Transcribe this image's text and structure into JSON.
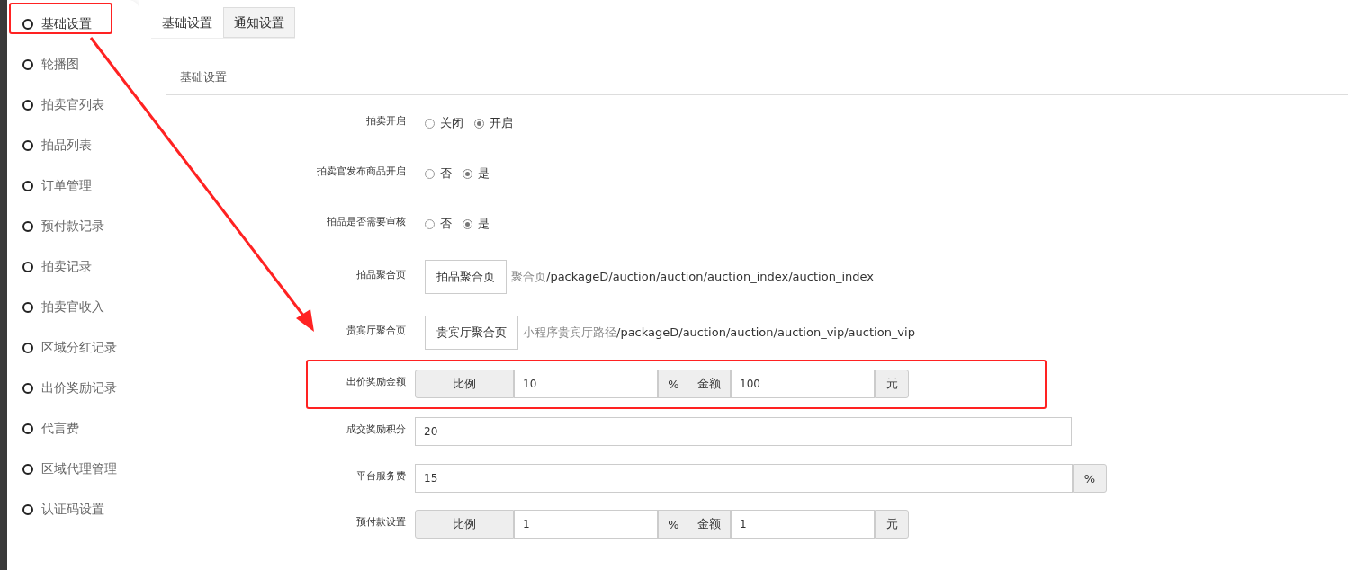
{
  "sidebar": {
    "items": [
      {
        "label": "基础设置",
        "selected": true
      },
      {
        "label": "轮播图",
        "selected": false
      },
      {
        "label": "拍卖官列表",
        "selected": false
      },
      {
        "label": "拍品列表",
        "selected": false
      },
      {
        "label": "订单管理",
        "selected": false
      },
      {
        "label": "预付款记录",
        "selected": false
      },
      {
        "label": "拍卖记录",
        "selected": false
      },
      {
        "label": "拍卖官收入",
        "selected": false
      },
      {
        "label": "区域分红记录",
        "selected": false
      },
      {
        "label": "出价奖励记录",
        "selected": false
      },
      {
        "label": "代言费",
        "selected": false
      },
      {
        "label": "区域代理管理",
        "selected": false
      },
      {
        "label": "认证码设置",
        "selected": false
      }
    ]
  },
  "tabs": [
    {
      "label": "基础设置",
      "selected": true
    },
    {
      "label": "通知设置",
      "selected": false
    }
  ],
  "section_title": "基础设置",
  "form": [
    {
      "kind": "radio",
      "label": "拍卖开启",
      "options": [
        {
          "label": "关闭",
          "selected": false
        },
        {
          "label": "开启",
          "selected": true
        }
      ]
    },
    {
      "kind": "radio",
      "label": "拍卖官发布商品开启",
      "options": [
        {
          "label": "否",
          "selected": false
        },
        {
          "label": "是",
          "selected": true
        }
      ]
    },
    {
      "kind": "radio",
      "label": "拍品是否需要审核",
      "options": [
        {
          "label": "否",
          "selected": false
        },
        {
          "label": "是",
          "selected": true
        }
      ]
    },
    {
      "kind": "link",
      "label": "拍品聚合页",
      "button": "拍品聚合页",
      "path_label": "聚合页",
      "path": "/packageD/auction/auction/auction_index/auction_index"
    },
    {
      "kind": "link",
      "label": "贵宾厅聚合页",
      "button": "贵宾厅聚合页",
      "path_label": "小程序贵宾厅路径",
      "path": "/packageD/auction/auction/auction_vip/auction_vip"
    },
    {
      "kind": "pair",
      "label": "出价奖励金额",
      "prefix": "比例",
      "value": "10",
      "unit": "%",
      "second_label": "金额",
      "second_value": "100",
      "second_unit": "元"
    },
    {
      "kind": "text",
      "label": "成交奖励积分",
      "value": "20"
    },
    {
      "kind": "suffix",
      "label": "平台服务费",
      "value": "15",
      "unit": "%"
    },
    {
      "kind": "pair",
      "label": "预付款设置",
      "prefix": "比例",
      "value": "1",
      "unit": "%",
      "second_label": "金额",
      "second_value": "1",
      "second_unit": "元"
    }
  ]
}
